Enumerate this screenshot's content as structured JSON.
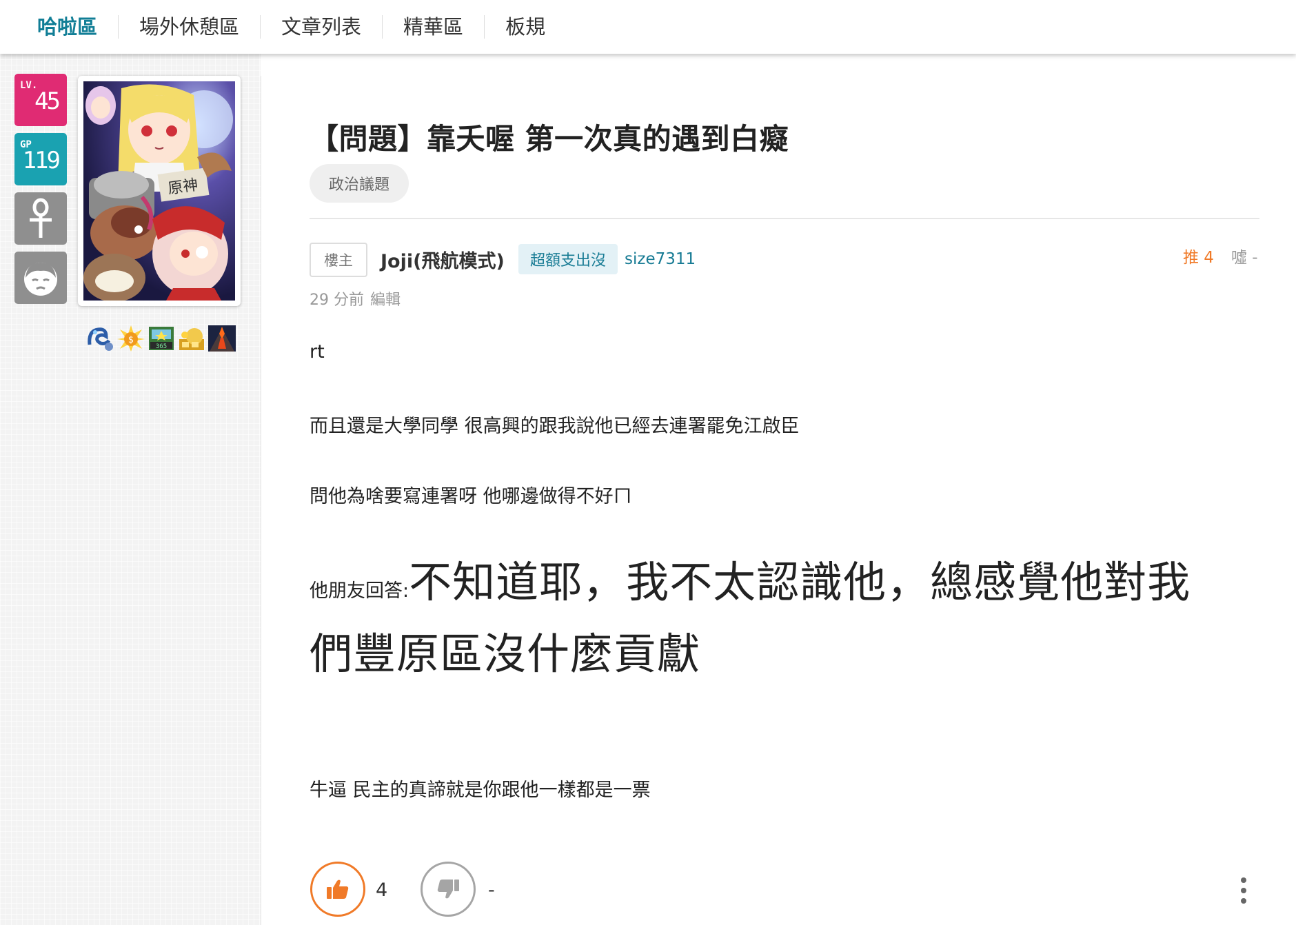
{
  "nav": {
    "items": [
      {
        "label": "哈啦區"
      },
      {
        "label": "場外休憩區"
      },
      {
        "label": "文章列表"
      },
      {
        "label": "精華區"
      },
      {
        "label": "板規"
      }
    ]
  },
  "sidebar": {
    "level_caption": "LV.",
    "level_value": "45",
    "gp_caption": "GP",
    "gp_value": "119",
    "icons": [
      "ankh-icon",
      "face-icon"
    ],
    "medals": [
      "dragon-medal-icon",
      "coin-medal-icon",
      "calendar-365-medal-icon",
      "gold-bag-medal-icon",
      "volcano-medal-icon"
    ]
  },
  "post": {
    "title": "【問題】靠夭喔 第一次真的遇到白癡",
    "tag": "政治議題",
    "floor_label": "樓主",
    "username": "Joji(飛航模式)",
    "user_badge": "超額支出沒",
    "user_id": "size7311",
    "push_label": "推 4",
    "boo_label": "噓 -",
    "time": "29 分前",
    "edit_label": "編輯",
    "body": {
      "p1": "rt",
      "p2": "而且還是大學同學 很高興的跟我說他已經去連署罷免江啟臣",
      "p3": "問他為啥要寫連署呀 他哪邊做得不好ㄇ",
      "p4_prefix": "他朋友回答:",
      "p4_big_line1": "不知道耶，我不太認識他，總感覺他對我",
      "p4_big_line2": "們豐原區沒什麼貢獻",
      "p5": "牛逼 民主的真諦就是你跟他一樣都是一票"
    },
    "gp_count": "4",
    "bp_count": "-"
  },
  "colors": {
    "accent": "#117e96",
    "level_box": "#e02b73",
    "gp_box": "#1aa2b1",
    "push": "#f07a28",
    "user_link": "#177b94"
  }
}
